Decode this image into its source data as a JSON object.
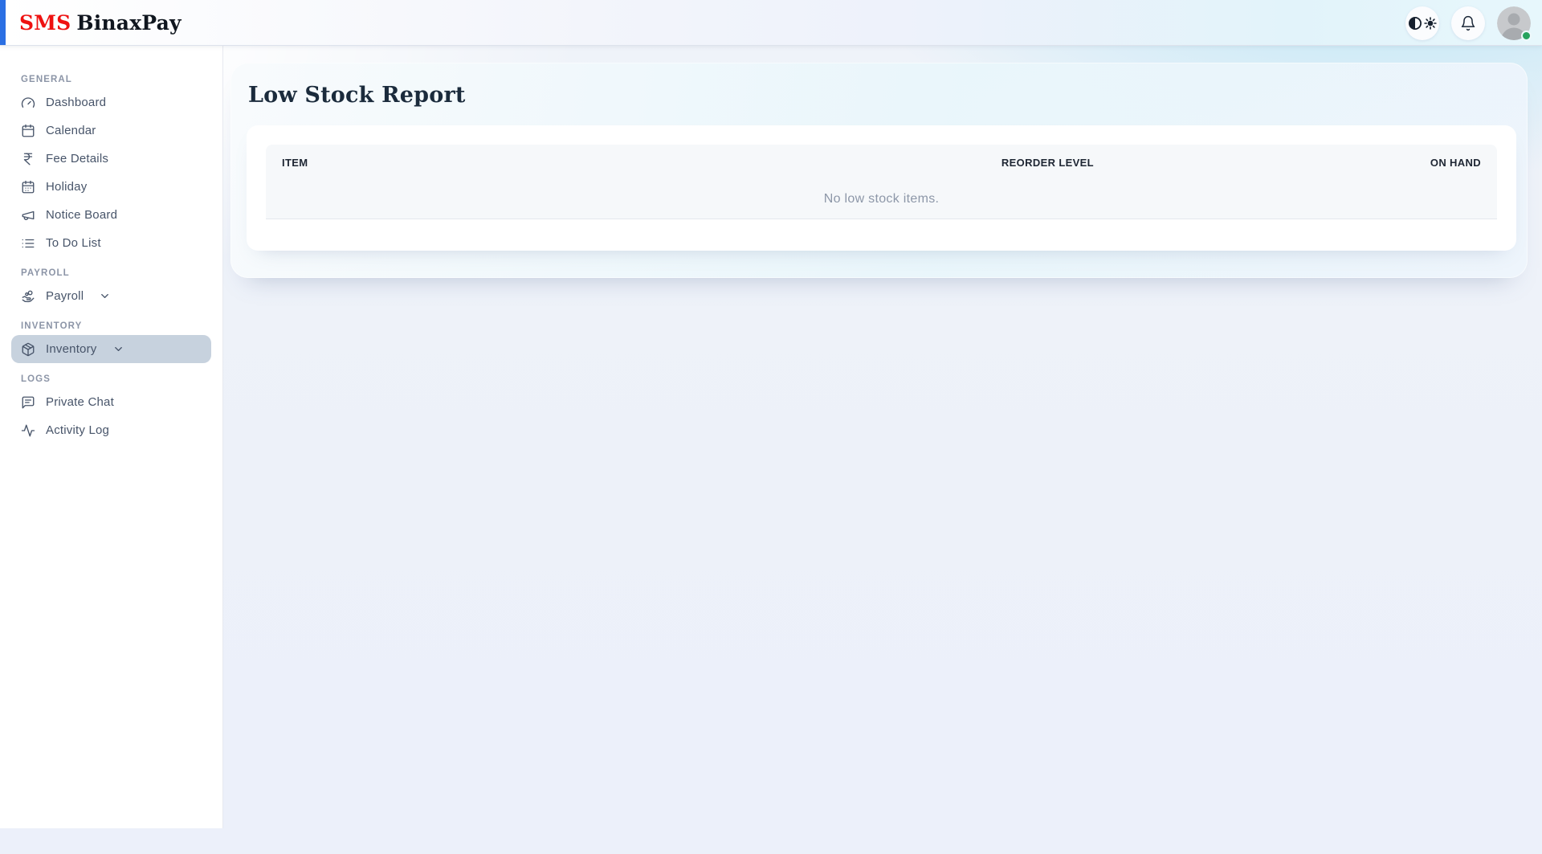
{
  "header": {
    "logo_prefix": "SMS",
    "logo_product": "BinaxPay",
    "icons": {
      "theme": "theme-contrast-sun-icon",
      "notifications": "bell-icon",
      "avatar": "user-avatar"
    }
  },
  "sidebar": {
    "sections": [
      {
        "label": "GENERAL",
        "items": [
          {
            "label": "Dashboard",
            "icon": "dashboard-gauge-icon"
          },
          {
            "label": "Calendar",
            "icon": "calendar-icon"
          },
          {
            "label": "Fee Details",
            "icon": "rupee-icon"
          },
          {
            "label": "Holiday",
            "icon": "holiday-calendar-icon"
          },
          {
            "label": "Notice Board",
            "icon": "megaphone-icon"
          },
          {
            "label": "To Do List",
            "icon": "todo-list-icon"
          }
        ]
      },
      {
        "label": "PAYROLL",
        "items": [
          {
            "label": "Payroll",
            "icon": "hand-coins-icon",
            "expandable": true
          }
        ]
      },
      {
        "label": "INVENTORY",
        "items": [
          {
            "label": "Inventory",
            "icon": "package-icon",
            "expandable": true,
            "active": true
          }
        ]
      },
      {
        "label": "LOGS",
        "items": [
          {
            "label": "Private Chat",
            "icon": "chat-icon"
          },
          {
            "label": "Activity Log",
            "icon": "activity-icon"
          }
        ]
      }
    ]
  },
  "main": {
    "title": "Low Stock Report",
    "table": {
      "columns": [
        "ITEM",
        "REORDER LEVEL",
        "ON HAND"
      ],
      "rows": [],
      "empty_message": "No low stock items."
    }
  },
  "status": {
    "user_online": true
  },
  "colors": {
    "accent_blue": "#2b6fe3",
    "logo_red": "#ee1111",
    "logo_dark": "#10161f",
    "active_item_bg": "#c7d2de",
    "online_green": "#27a35e",
    "heading_navy": "#1b2b3c",
    "sidebar_text": "#475469",
    "muted_text": "#8d97a8",
    "header_cyan": "#e2f3fa"
  }
}
